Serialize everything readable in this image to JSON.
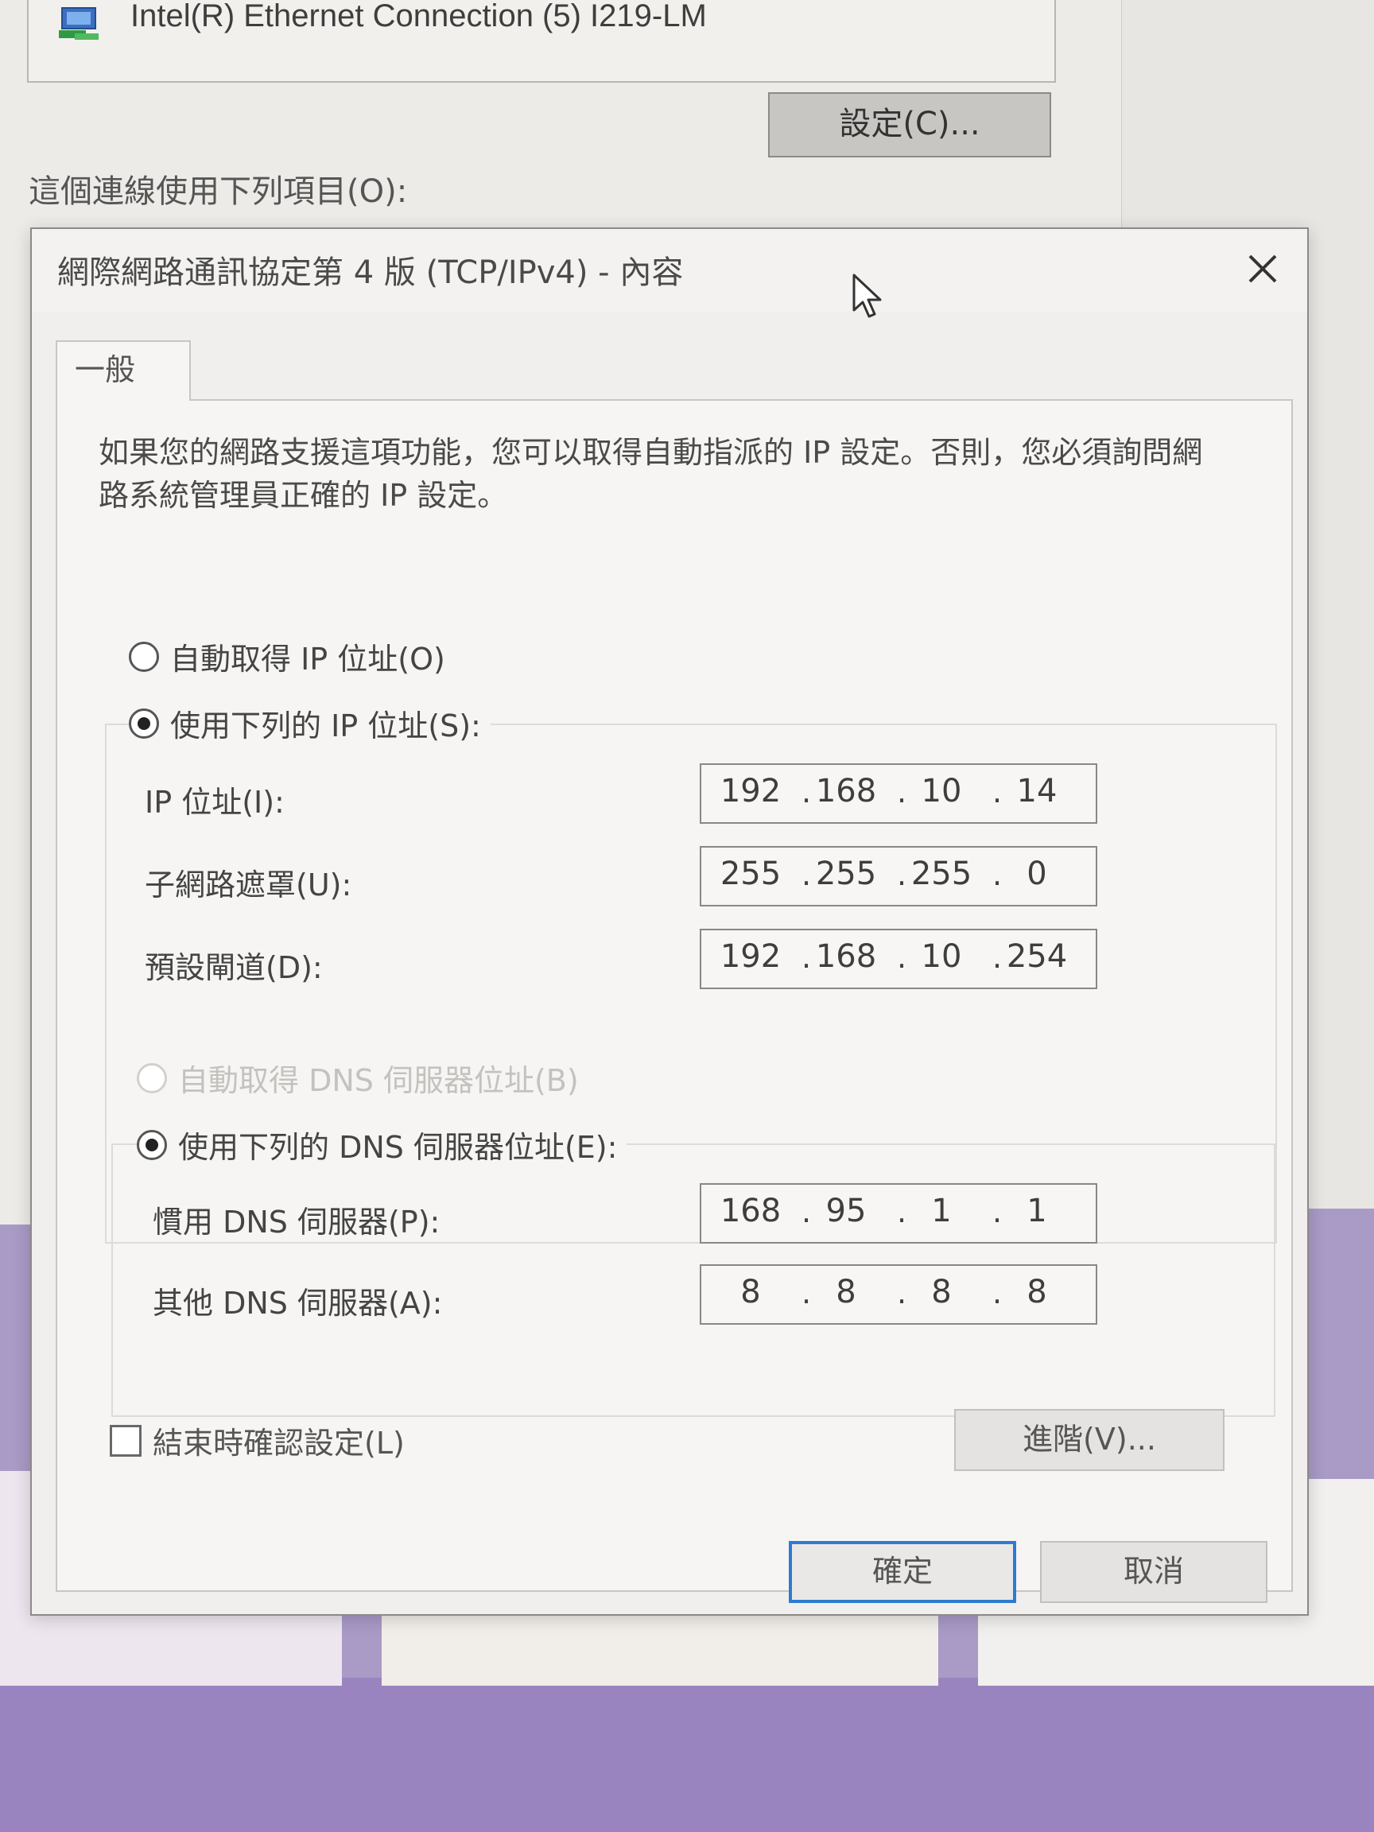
{
  "parent_window": {
    "adapter_name": "Intel(R) Ethernet Connection (5) I219-LM",
    "configure_label": "設定(C)...",
    "items_label": "這個連線使用下列項目(O):"
  },
  "dialog": {
    "title": "網際網路通訊協定第 4 版 (TCP/IPv4) - 內容",
    "tab_general": "一般",
    "description": "如果您的網路支援這項功能，您可以取得自動指派的 IP 設定。否則，您必須詢問網路系統管理員正確的 IP 設定。",
    "ip_mode": {
      "auto_label": "自動取得 IP 位址(O)",
      "manual_label": "使用下列的 IP 位址(S):",
      "selected": "manual"
    },
    "ip_address": {
      "label": "IP 位址(I):",
      "octets": [
        "192",
        "168",
        "10",
        "14"
      ]
    },
    "subnet_mask": {
      "label": "子網路遮罩(U):",
      "octets": [
        "255",
        "255",
        "255",
        "0"
      ]
    },
    "default_gateway": {
      "label": "預設閘道(D):",
      "octets": [
        "192",
        "168",
        "10",
        "254"
      ]
    },
    "dns_mode": {
      "auto_label": "自動取得 DNS 伺服器位址(B)",
      "manual_label": "使用下列的 DNS 伺服器位址(E):",
      "selected": "manual",
      "auto_disabled": true
    },
    "preferred_dns": {
      "label": "慣用 DNS 伺服器(P):",
      "octets": [
        "168",
        "95",
        "1",
        "1"
      ]
    },
    "alternate_dns": {
      "label": "其他 DNS 伺服器(A):",
      "octets": [
        "8",
        "8",
        "8",
        "8"
      ]
    },
    "validate_on_exit": {
      "label": "結束時確認設定(L)",
      "checked": false
    },
    "advanced_label": "進階(V)...",
    "ok_label": "確定",
    "cancel_label": "取消"
  },
  "colors": {
    "default_button_border": "#2e7bd1",
    "desktop_purple": "#a99ac6"
  }
}
